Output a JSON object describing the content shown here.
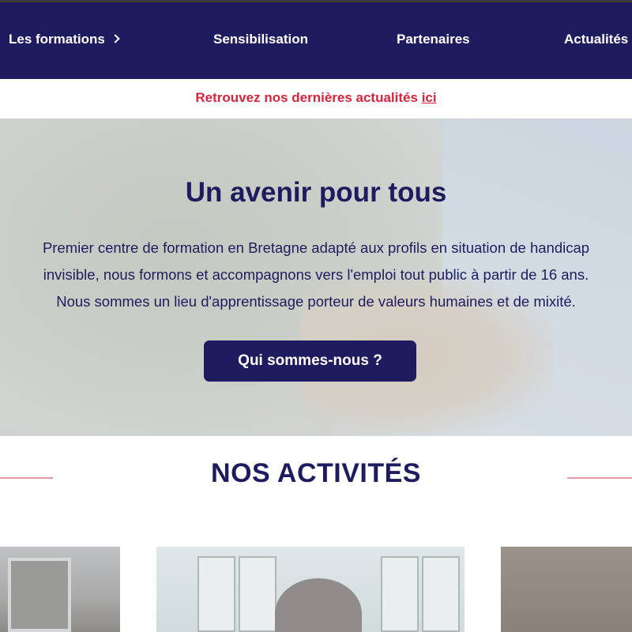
{
  "nav": {
    "items": [
      {
        "label": "Les formations",
        "has_submenu": true
      },
      {
        "label": "Sensibilisation",
        "has_submenu": false
      },
      {
        "label": "Partenaires",
        "has_submenu": false
      },
      {
        "label": "Actualités",
        "has_submenu": false
      }
    ]
  },
  "announcement": {
    "text": "Retrouvez nos dernières actualités ",
    "link_label": "ici"
  },
  "hero": {
    "title": "Un avenir pour tous",
    "lines": [
      "Premier centre de formation en Bretagne adapté aux profils en situation de handicap",
      "invisible, nous formons et accompagnons vers l'emploi tout public à partir de 16 ans.",
      "Nous sommes un lieu d'apprentissage porteur de valeurs humaines et de mixité."
    ],
    "button_label": "Qui sommes-nous ?"
  },
  "activities": {
    "title": "NOS ACTIVITÉS"
  },
  "colors": {
    "navy": "#1e1c5e",
    "accent_red": "#d3263e",
    "rule_pink": "#e79aa4"
  }
}
